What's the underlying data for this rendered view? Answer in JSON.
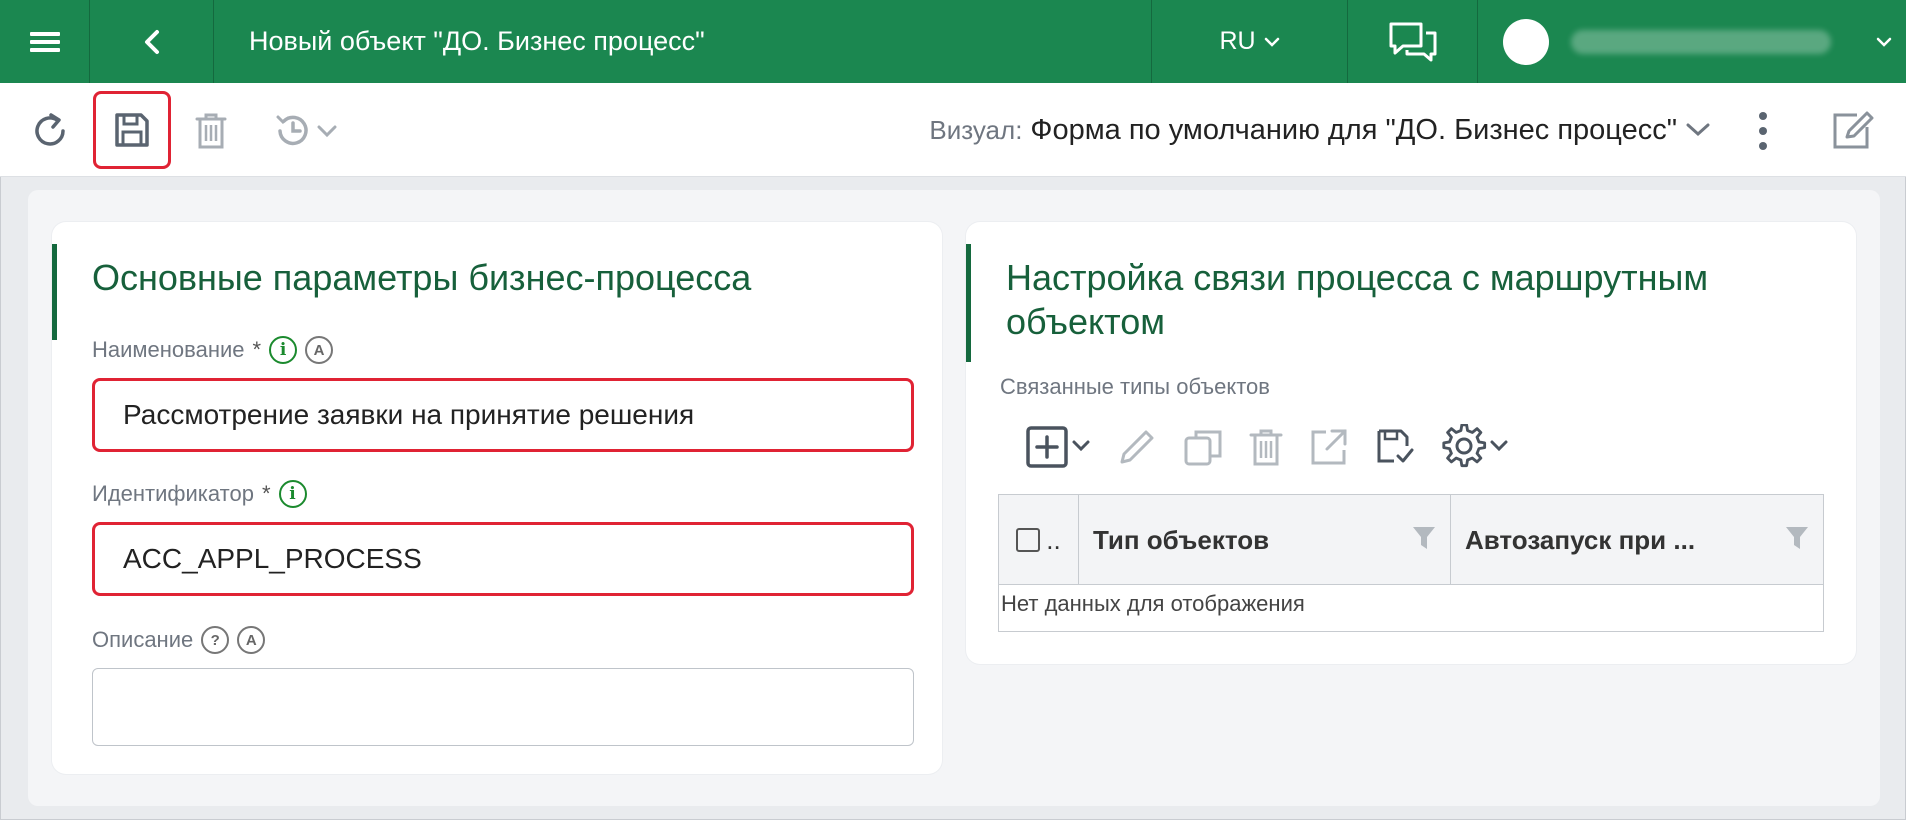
{
  "header": {
    "title": "Новый объект \"ДО. Бизнес процесс\"",
    "lang": "RU",
    "accent": "#1b8750",
    "icons": [
      "menu-icon",
      "back-icon",
      "chat-icon",
      "chevron-down-icon"
    ]
  },
  "toolbar": {
    "visual_label": "Визуал:",
    "visual_value": "Форма по умолчанию для \"ДО. Бизнес процесс\"",
    "icons": [
      "refresh-icon",
      "save-icon",
      "delete-icon",
      "history-icon",
      "more-icon",
      "edit-icon"
    ]
  },
  "left_card": {
    "title": "Основные параметры бизнес-процесса",
    "name_label": "Наименование",
    "name_value": "Рассмотрение заявки на принятие решения",
    "id_label": "Идентификатор",
    "id_value": "ACC_APPL_PROCESS",
    "desc_label": "Описание",
    "desc_value": "",
    "required_mark": "*",
    "info_glyph": "i",
    "auto_glyph": "A",
    "help_glyph": "?"
  },
  "right_card": {
    "title": "Настройка связи процесса с маршрутным объектом",
    "related_label": "Связанные типы объектов",
    "columns": [
      "Тип объектов",
      "Автозапуск при ..."
    ],
    "check_col": "..",
    "empty_text": "Нет данных для отображения"
  },
  "colors": {
    "header_bg": "#1b8750",
    "title_text": "#17603b",
    "highlight": "#e02334",
    "info_green": "#1b8a2e"
  }
}
